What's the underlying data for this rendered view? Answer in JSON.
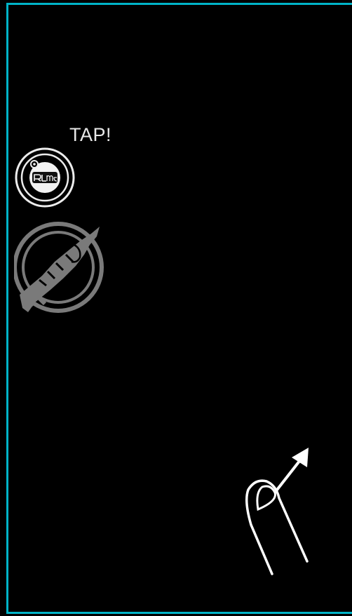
{
  "hud": {
    "tap_prompt": "TAP!"
  },
  "buttons": {
    "badge_icon": "badge-logo-icon",
    "emblem_icon": "handshake-emblem-icon"
  },
  "tutorial": {
    "gesture_icon": "swipe-finger-icon",
    "direction": "up-right"
  },
  "colors": {
    "background": "#000000",
    "frame": "#00b4c8",
    "icon": "#e8e8e8",
    "emblem": "#7a7a7a"
  }
}
